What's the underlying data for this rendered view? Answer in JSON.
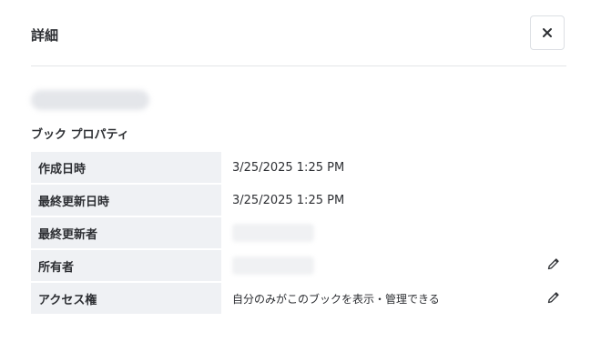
{
  "header": {
    "title": "詳細"
  },
  "section": {
    "title": "ブック プロパティ"
  },
  "properties": [
    {
      "label": "作成日時",
      "value": "3/25/2025 1:25 PM"
    },
    {
      "label": "最終更新日時",
      "value": "3/25/2025 1:25 PM"
    },
    {
      "label": "最終更新者",
      "value": ""
    },
    {
      "label": "所有者",
      "value": ""
    },
    {
      "label": "アクセス権",
      "value": "自分のみがこのブックを表示・管理できる"
    }
  ],
  "icons": {
    "close": "close-icon",
    "edit": "pencil-icon"
  },
  "colors": {
    "key_background": "#eff1f4",
    "text": "#2d2f33",
    "divider": "#e3e5e8"
  }
}
